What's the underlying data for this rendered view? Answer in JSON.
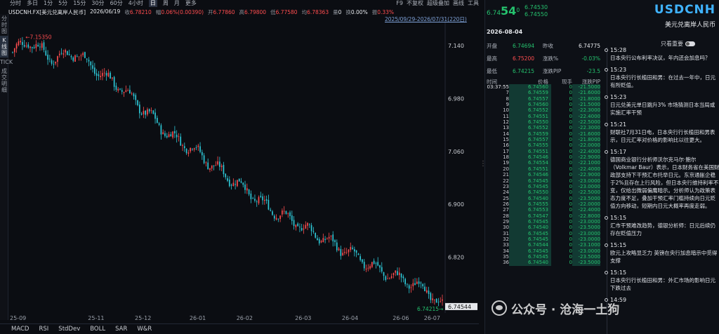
{
  "left_toolbar": [
    "分时图",
    "K线图",
    "TICK",
    "成交明细"
  ],
  "toolbar": {
    "items": [
      "分时",
      "多日",
      "1分",
      "5分",
      "15分",
      "30分",
      "60分",
      "4小时",
      "日",
      "周",
      "月",
      "更多"
    ],
    "active": "日",
    "right_items": [
      "F9",
      "不复权",
      "超级叠加",
      "画线",
      "工具"
    ]
  },
  "info": {
    "symbol_name": "USDCNH.FX[美元兑离岸人民币]",
    "date": "2026/06/19",
    "close_label": "收",
    "close": "6.78210",
    "change_label": "幅",
    "change": "0.06%(0.00390)",
    "open_label": "开",
    "open": "6.77860",
    "high_label": "高",
    "high": "6.79800",
    "low_label": "低",
    "low": "6.77580",
    "avg_label": "均",
    "avg": "6.78363",
    "vol_label": "量",
    "vol": "0",
    "turnover_label": "换",
    "turnover": "0.00%",
    "amp_label": "振",
    "amp": "0.33%"
  },
  "date_range": "2025/09/29-2026/07/31(220日)",
  "chart_data": {
    "type": "candlestick",
    "x_ticks": [
      "25-09",
      "25-11",
      "25-12",
      "26-01",
      "26-02",
      "26-03",
      "26-04",
      "26-06",
      "26-07"
    ],
    "y_ticks": [
      7.14,
      6.98,
      7.06,
      6.9,
      6.82
    ],
    "y_tick_labels": [
      "7.140",
      "7.060",
      "6.980",
      "6.900",
      "6.820"
    ],
    "ylim": [
      6.74,
      7.175
    ],
    "max_label": "7.15350",
    "last_label": "6.74215",
    "price_tag": "6.74544",
    "anchors": [
      [
        0,
        7.13
      ],
      [
        8,
        7.148
      ],
      [
        20,
        7.12
      ],
      [
        32,
        7.13
      ],
      [
        44,
        7.1
      ],
      [
        56,
        7.075
      ],
      [
        68,
        7.04
      ],
      [
        80,
        7.005
      ],
      [
        92,
        6.985
      ],
      [
        104,
        6.955
      ],
      [
        116,
        6.93
      ],
      [
        128,
        6.9
      ],
      [
        140,
        6.88
      ],
      [
        152,
        6.86
      ],
      [
        164,
        6.84
      ],
      [
        176,
        6.82
      ],
      [
        188,
        6.8
      ],
      [
        200,
        6.785
      ],
      [
        210,
        6.775
      ],
      [
        220,
        6.745
      ]
    ],
    "colors": {
      "up": "#ff4d4f",
      "down": "#2ec7d6"
    }
  },
  "bottom_tabs": [
    "MACD",
    "RSI",
    "StdDev",
    "BOLL",
    "SAR",
    "W&R"
  ],
  "panel": {
    "price_main": "6.74",
    "price_big": "54",
    "price_sup": "0",
    "bid": "6.74530",
    "ask": "6.74550",
    "symbol": "USDCNH",
    "name": "美元兑离岸人民币",
    "date": "2026-08-04",
    "quote": [
      {
        "k1": "开盘",
        "v1": "6.74694",
        "c1": "green",
        "k2": "昨收",
        "v2": "6.74775",
        "c2": "white"
      },
      {
        "k1": "最高",
        "v1": "6.75200",
        "c1": "red",
        "k2": "涨跌%",
        "v2": "-0.03%",
        "c2": "green"
      },
      {
        "k1": "最低",
        "v1": "6.74215",
        "c1": "green",
        "k2": "涨跌PIP",
        "v2": "-23.5",
        "c2": "green"
      }
    ],
    "tick_headers": [
      "时间",
      "价格",
      "现手",
      "涨跌PIP"
    ],
    "ticks": [
      [
        "03:37:55",
        "6.74560",
        "0",
        "-21.5000"
      ],
      [
        "7",
        "6.74559",
        "0",
        "-21.6000"
      ],
      [
        "8",
        "6.74557",
        "0",
        "-21.8000"
      ],
      [
        "9",
        "6.74560",
        "0",
        "-21.5000"
      ],
      [
        "10",
        "6.74552",
        "0",
        "-22.3000"
      ],
      [
        "11",
        "6.74551",
        "0",
        "-22.4000"
      ],
      [
        "12",
        "6.74550",
        "0",
        "-22.5000"
      ],
      [
        "13",
        "6.74552",
        "0",
        "-22.3000"
      ],
      [
        "14",
        "6.74559",
        "0",
        "-21.6000"
      ],
      [
        "15",
        "6.74557",
        "0",
        "-21.8000"
      ],
      [
        "16",
        "6.74555",
        "0",
        "-22.0000"
      ],
      [
        "17",
        "6.74551",
        "0",
        "-22.4000"
      ],
      [
        "18",
        "6.74546",
        "0",
        "-22.9000"
      ],
      [
        "19",
        "6.74554",
        "0",
        "-22.1000"
      ],
      [
        "20",
        "6.74551",
        "0",
        "-22.4000"
      ],
      [
        "21",
        "6.74546",
        "0",
        "-22.9000"
      ],
      [
        "22",
        "6.74545",
        "0",
        "-23.0000"
      ],
      [
        "23",
        "6.74545",
        "0",
        "-23.0000"
      ],
      [
        "24",
        "6.74550",
        "0",
        "-22.5000"
      ],
      [
        "25",
        "6.74540",
        "0",
        "-23.5000"
      ],
      [
        "26",
        "6.74555",
        "0",
        "-22.0000"
      ],
      [
        "27",
        "6.74553",
        "0",
        "-22.4000"
      ],
      [
        "28",
        "6.74547",
        "0",
        "-22.8000"
      ],
      [
        "29",
        "6.74545",
        "0",
        "-23.0000"
      ],
      [
        "30",
        "6.74540",
        "0",
        "-23.5000"
      ],
      [
        "31",
        "6.74545",
        "0",
        "-23.0000"
      ],
      [
        "32",
        "6.74545",
        "0",
        "-23.0000"
      ],
      [
        "33",
        "6.74544",
        "0",
        "-23.1000"
      ],
      [
        "34",
        "6.74545",
        "0",
        "-23.0000"
      ],
      [
        "35",
        "6.74545",
        "0",
        "-23.5000"
      ],
      [
        "36",
        "6.74540",
        "0",
        "-23.5000"
      ]
    ],
    "news_toggle_label": "只看重要",
    "news": [
      {
        "time": "15:28",
        "text": "日本央行公布利率决议，年内还会加息吗？"
      },
      {
        "time": "15:23",
        "text": "日本央行行长植田和男：在过去一年中，日元有所贬值。"
      },
      {
        "time": "15:23",
        "text": "日元兑美元单日跳升3% 市场猜测日本当局或实施汇率干预"
      },
      {
        "time": "15:21",
        "text": "财联社7月31日电，日本央行行长植田和男表示，日元汇率对价格的影响比以往更大。"
      },
      {
        "time": "15:17",
        "text": "德国商业银行分析师沃尔克马尔·鲍尔（Volkmar Baur）表示，日本财务省在美国财政部支持下干预汇市托举日元。东京通胀企稳于2%且存在上行风险，但日本央行维持利率不变，仅给出微弱偏鹰暗示。分析师认为政策表态力度不足，叠加干预汇率门槛持续向日元贬值方向移动，短期内日元大概率再度走弱。"
      },
      {
        "time": "15:15",
        "text": "汇市干预难改趋势，德银分析师：日元后续仍存在贬值压力"
      },
      {
        "time": "15:15",
        "text": "欧元上攻略显乏力 英镑在央行加息暗示中觅得支撑"
      },
      {
        "time": "15:15",
        "text": "日本央行行长植田和男：外汇市场的影响日元下跌过去"
      },
      {
        "time": "14:59",
        "text": ""
      }
    ]
  },
  "watermark": "公众号 · 沧海一土狗"
}
